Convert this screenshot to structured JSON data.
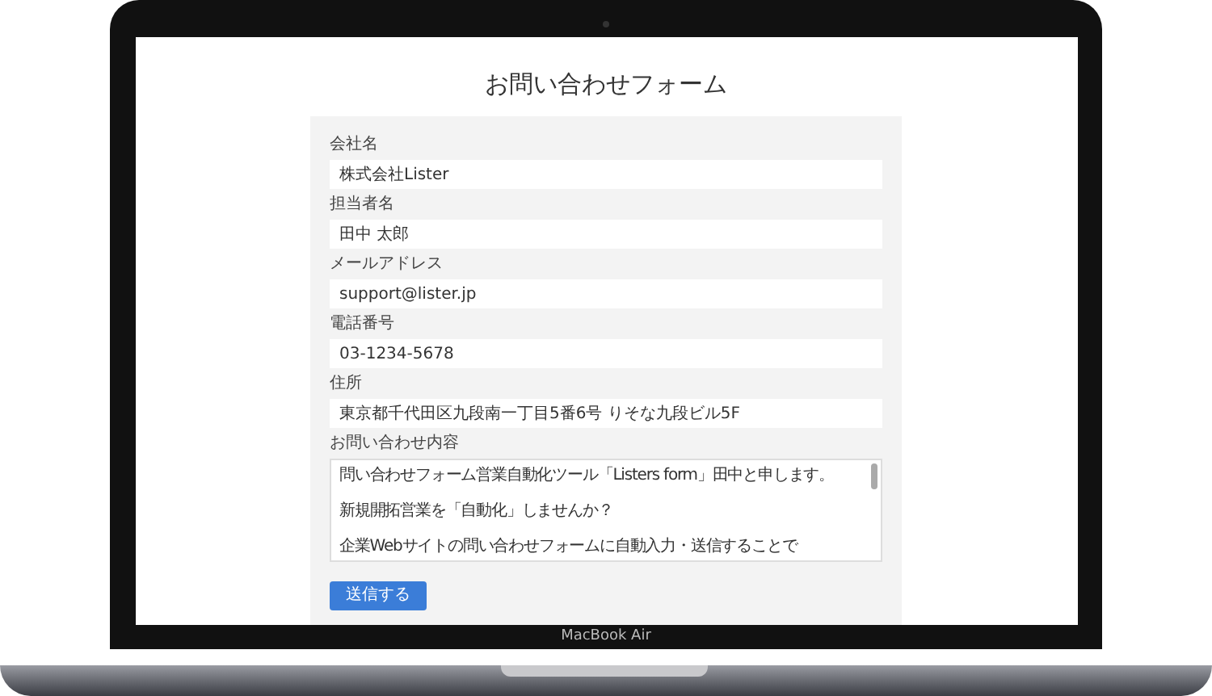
{
  "page": {
    "title": "お問い合わせフォーム"
  },
  "fields": [
    {
      "kind": "input",
      "label": "会社名",
      "value": "株式会社Lister"
    },
    {
      "kind": "input",
      "label": "担当者名",
      "value": "田中 太郎"
    },
    {
      "kind": "input",
      "label": "メールアドレス",
      "value": "support@lister.jp"
    },
    {
      "kind": "input",
      "label": "電話番号",
      "value": "03-1234-5678"
    },
    {
      "kind": "input",
      "label": "住所",
      "value": "東京都千代田区九段南一丁目5番6号 りそな九段ビル5F"
    },
    {
      "kind": "textarea",
      "label": "お問い合わせ内容",
      "paragraphs": [
        "問い合わせフォーム営業自動化ツール「Listers form」田中と申します。",
        "新規開拓営業を「自動化」しませんか？",
        "企業Webサイトの問い合わせフォームに自動入力・送信することで"
      ]
    }
  ],
  "submit_button": "送信する",
  "laptop": {
    "model_label": "MacBook Air"
  }
}
